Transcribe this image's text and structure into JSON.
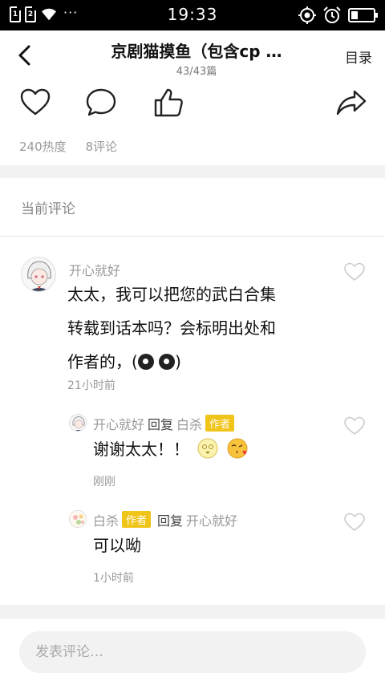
{
  "status_bar": {
    "sim1": "1",
    "sim2": "2",
    "more": "···",
    "time": "19:33"
  },
  "header": {
    "title": "京剧猫摸鱼（包含cp …",
    "subtitle": "43/43篇",
    "toc_label": "目录"
  },
  "actions": {
    "icons": [
      "heart-icon",
      "comment-icon",
      "thumbs-up-icon",
      "share-icon"
    ]
  },
  "stats": {
    "heat": "240热度",
    "comments": "8评论"
  },
  "section": {
    "title": "当前评论"
  },
  "comment": {
    "author": "开心就好",
    "text_line1": "太太，我可以把您的武白合集",
    "text_line2": "转载到话本吗？会标明出处和",
    "text_line3": "作者的，(",
    "text_line3_end": ")",
    "time": "21小时前",
    "replies": [
      {
        "author": "开心就好",
        "reply_word": "回复",
        "target": "白杀",
        "target_badge": "作者",
        "text": "谢谢太太！！",
        "time": "刚刚"
      },
      {
        "author": "白杀",
        "author_badge": "作者",
        "reply_word": "回复",
        "target": "开心就好",
        "text": "可以呦",
        "time": "1小时前"
      }
    ]
  },
  "input": {
    "placeholder": "发表评论…"
  },
  "colors": {
    "badge": "#f0c419",
    "muted": "#999999",
    "divider": "#f2f2f2"
  }
}
